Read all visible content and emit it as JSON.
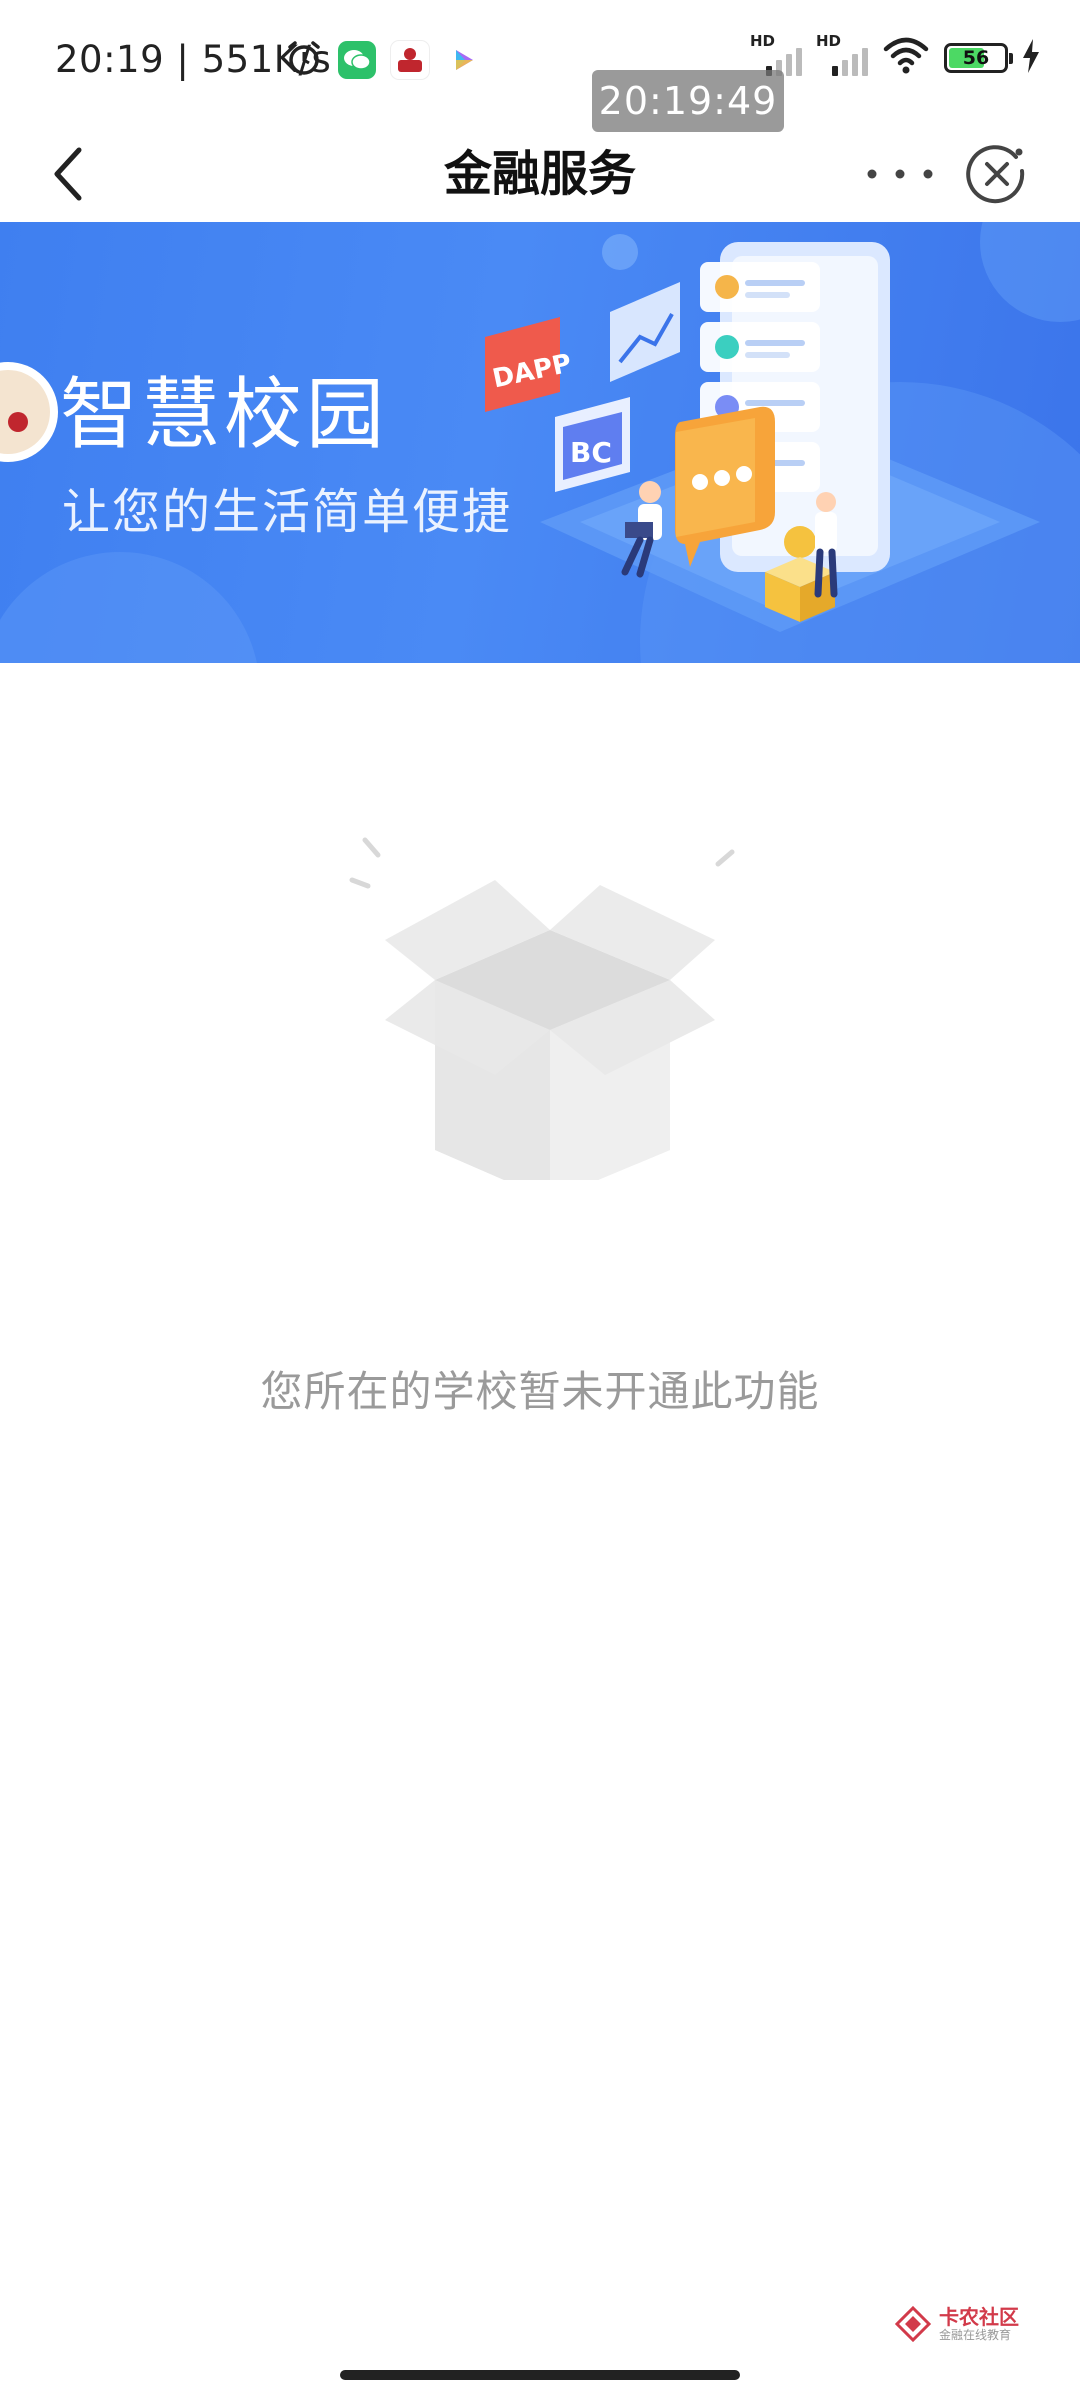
{
  "status_bar": {
    "time": "20:19 | 551K/s",
    "hd_1": "HD",
    "hd_2": "HD",
    "battery": "56",
    "app_icons": [
      "alarm-icon",
      "wechat-icon",
      "app-red-icon",
      "video-app-icon"
    ]
  },
  "overlay": {
    "timestamp": "20:19:49"
  },
  "title_bar": {
    "title": "金融服务"
  },
  "banner": {
    "title": "智慧校园",
    "subtitle": "让您的生活简单便捷",
    "tag_dapp": "DAPP",
    "tag_bc": "BC"
  },
  "empty_state": {
    "message": "您所在的学校暂未开通此功能"
  },
  "watermark": {
    "main": "卡农社区",
    "sub": "金融在线教育"
  },
  "colors": {
    "banner_blue": "#4a8af5",
    "empty_text": "#9a9a9a",
    "battery_green": "#4cd964"
  }
}
